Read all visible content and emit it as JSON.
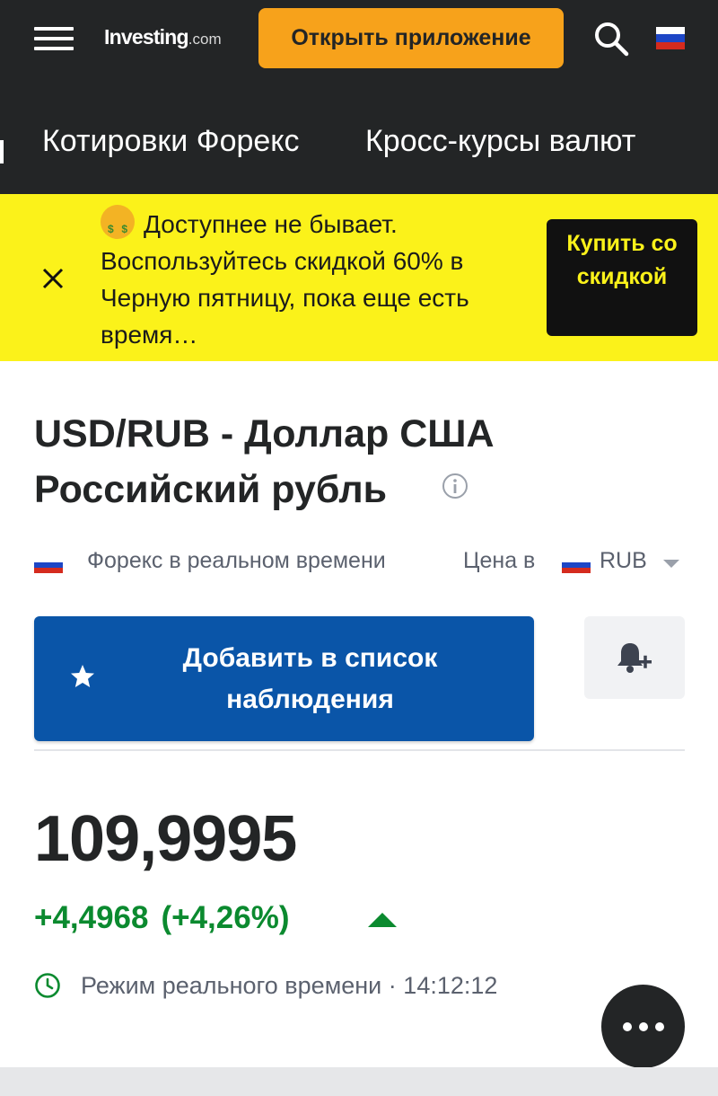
{
  "header": {
    "logo_main": "Investing",
    "logo_suffix": ".com",
    "open_app_label": "Открыть приложение",
    "nav": [
      {
        "label": "Котировки Форекс"
      },
      {
        "label": "Кросс-курсы валют"
      }
    ]
  },
  "promo": {
    "text": "Доступнее не бывает. Воспользуйтесь скидкой 60% в Черную пятницу, пока еще есть время…",
    "button_label": "Купить со скидкой"
  },
  "instrument": {
    "title": "USD/RUB - Доллар США Российский рубль",
    "source": "Форекс в реальном времени",
    "price_in_label": "Цена в",
    "currency": "RUB"
  },
  "actions": {
    "watchlist_label": "Добавить в список наблюдения"
  },
  "quote": {
    "price": "109,9995",
    "change": "+4,4968",
    "change_pct": "(+4,26%)",
    "mode_label": "Режим реального времени",
    "separator": "·",
    "time": "14:12:12"
  },
  "colors": {
    "header_bg": "#232526",
    "accent_orange": "#f7a21b",
    "promo_yellow": "#fbf21a",
    "primary_blue": "#0a55a8",
    "positive_green": "#0b8a2f"
  },
  "icons": {
    "menu": "hamburger-icon",
    "search": "search-icon",
    "flag": "russia-flag-icon",
    "close": "close-icon",
    "info": "info-icon",
    "star": "star-icon",
    "alert": "bell-plus-icon",
    "clock": "clock-icon",
    "more": "more-icon"
  }
}
